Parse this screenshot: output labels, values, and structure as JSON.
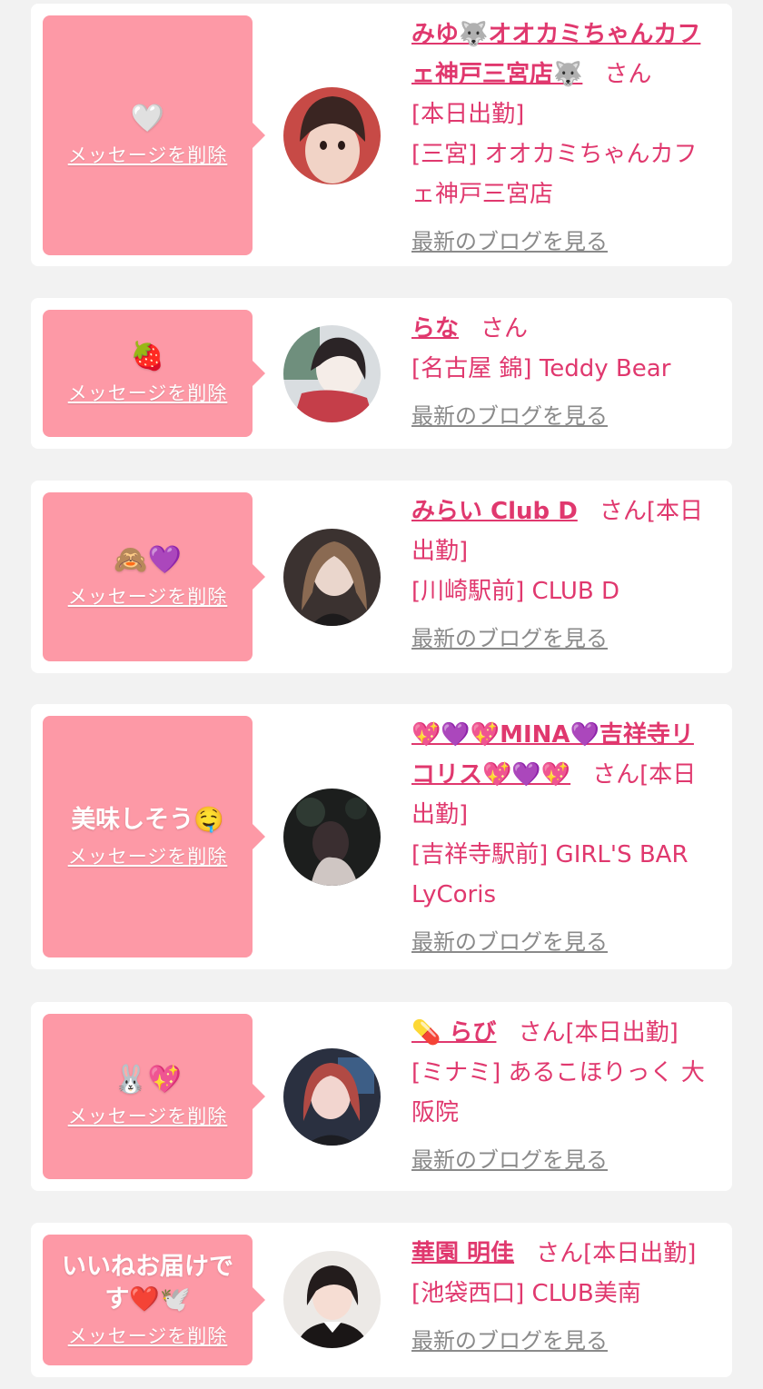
{
  "delete_label": "メッセージを削除",
  "blog_label": "最新のブログを見る",
  "san_label": "さん",
  "colors": {
    "background": "#f2f2f2",
    "bubble": "#fd99a6",
    "accent_text": "#e0386e",
    "link_gray": "#8a8a8a"
  },
  "cards": [
    {
      "message": "🤍",
      "name": "みゆ🐺オオカミちゃんカフェ神戸三宮店🐺",
      "status": "[本日出勤]",
      "location": "[三宮] オオカミちゃんカフェ神戸三宮店",
      "avatar": "avatar-photo-1"
    },
    {
      "message": "🍓",
      "name": "らな",
      "status": "",
      "location": "[名古屋 錦] Teddy Bear",
      "avatar": "avatar-photo-2"
    },
    {
      "message": "🙈💜",
      "name": "みらい Club D",
      "status": "[本日出勤]",
      "location": "[川崎駅前] CLUB D",
      "avatar": "avatar-photo-3"
    },
    {
      "message": "美味しそう🤤",
      "name": "💖💜💖MINA💜吉祥寺リコリス💖💜💖",
      "status": "[本日出勤]",
      "location": "[吉祥寺駅前] GIRL'S BAR LyCoris",
      "avatar": "avatar-photo-4"
    },
    {
      "message": "🐰💖",
      "name": "💊 らび",
      "status": "[本日出勤]",
      "location": "[ミナミ] あるこほりっく 大阪院",
      "avatar": "avatar-photo-5"
    },
    {
      "message": "いいねお届けです❤️🕊️",
      "name": "華園 明佳",
      "status": "[本日出勤]",
      "location": "[池袋西口] CLUB美南",
      "avatar": "avatar-photo-6"
    }
  ]
}
